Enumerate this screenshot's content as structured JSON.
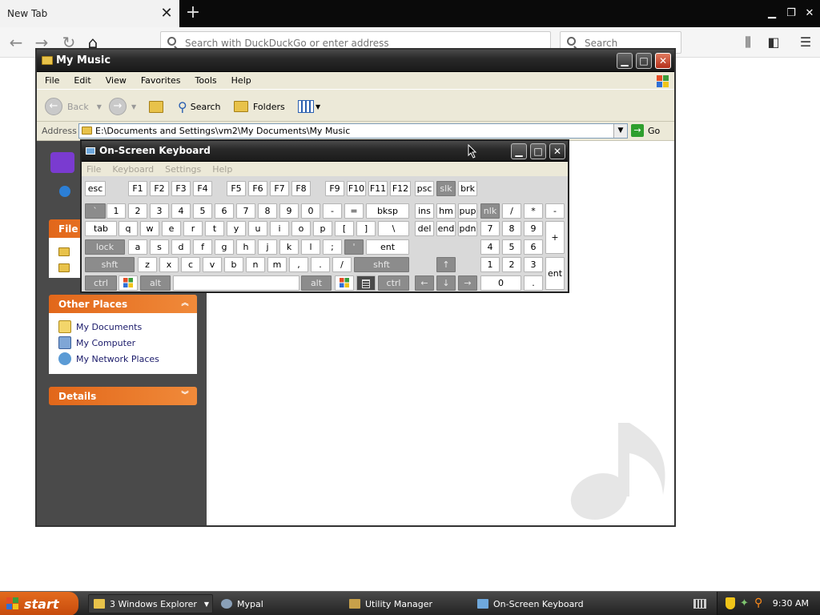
{
  "browser": {
    "tab_title": "New Tab",
    "url_placeholder": "Search with DuckDuckGo or enter address",
    "search_placeholder": "Search"
  },
  "explorer": {
    "title": "My Music",
    "menu": [
      "File",
      "Edit",
      "View",
      "Favorites",
      "Tools",
      "Help"
    ],
    "toolbar": {
      "back": "Back",
      "search": "Search",
      "folders": "Folders"
    },
    "address_label": "Address",
    "address_value": "E:\\Documents and Settings\\vm2\\My Documents\\My Music",
    "go_label": "Go",
    "left_panel": {
      "file_tasks_head": "File a",
      "other_places": {
        "title": "Other Places",
        "items": [
          "My Documents",
          "My Computer",
          "My Network Places"
        ]
      },
      "details": {
        "title": "Details"
      }
    }
  },
  "osk": {
    "title": "On-Screen Keyboard",
    "menu": [
      "File",
      "Keyboard",
      "Settings",
      "Help"
    ],
    "keys": {
      "esc": "esc",
      "f1": "F1",
      "f2": "F2",
      "f3": "F3",
      "f4": "F4",
      "f5": "F5",
      "f6": "F6",
      "f7": "F7",
      "f8": "F8",
      "f9": "F9",
      "f10": "F10",
      "f11": "F11",
      "f12": "F12",
      "psc": "psc",
      "slk": "slk",
      "brk": "brk",
      "bq": "`",
      "n1": "1",
      "n2": "2",
      "n3": "3",
      "n4": "4",
      "n5": "5",
      "n6": "6",
      "n7": "7",
      "n8": "8",
      "n9": "9",
      "n0": "0",
      "minus": "-",
      "eq": "=",
      "bksp": "bksp",
      "ins": "ins",
      "hm": "hm",
      "pup": "pup",
      "nlk": "nlk",
      "ndiv": "/",
      "nmul": "*",
      "nsub": "-",
      "tab": "tab",
      "q": "q",
      "w": "w",
      "e": "e",
      "r": "r",
      "t": "t",
      "y": "y",
      "u": "u",
      "i": "i",
      "o": "o",
      "p": "p",
      "lbr": "[",
      "rbr": "]",
      "bsl": "\\",
      "del": "del",
      "end": "end",
      "pdn": "pdn",
      "np7": "7",
      "np8": "8",
      "np9": "9",
      "nadd": "+",
      "lock": "lock",
      "a": "a",
      "s": "s",
      "d": "d",
      "f": "f",
      "g": "g",
      "h": "h",
      "j": "j",
      "k": "k",
      "l": "l",
      "semi": ";",
      "quote": "'",
      "ent": "ent",
      "np4": "4",
      "np5": "5",
      "np6": "6",
      "shft": "shft",
      "z": "z",
      "x": "x",
      "c": "c",
      "v": "v",
      "b": "b",
      "n": "n",
      "m": "m",
      "comma": ",",
      "dot": ".",
      "slash": "/",
      "rshft": "shft",
      "up": "↑",
      "np1": "1",
      "np2": "2",
      "np3": "3",
      "nent": "ent",
      "ctrl": "ctrl",
      "alt": "alt",
      "ralt": "alt",
      "rctrl": "ctrl",
      "left": "←",
      "down": "↓",
      "right": "→",
      "np0": "0",
      "ndot": "."
    }
  },
  "taskbar": {
    "start": "start",
    "tasks": [
      "3 Windows Explorer",
      "Mypal",
      "Utility Manager",
      "On-Screen Keyboard"
    ],
    "clock": "9:30 AM"
  },
  "colors": {
    "xp_orange": "#e2671a",
    "taskbar": "#2a2a2a",
    "start": "#d9561a"
  }
}
